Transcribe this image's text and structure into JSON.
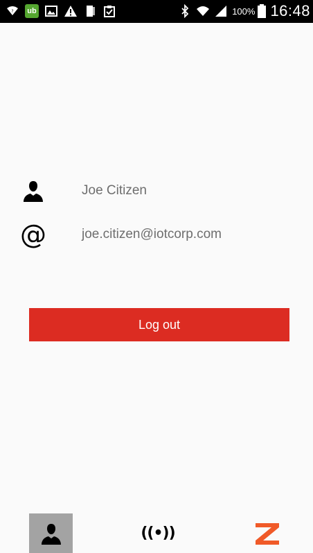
{
  "status_bar": {
    "battery_percent": "100%",
    "time": "16:48",
    "ub_label": "ub",
    "icons": [
      "wifi-icon",
      "ub-app-icon",
      "image-icon",
      "warning-icon",
      "sim-icon",
      "clipboard-check-icon",
      "bluetooth-icon",
      "wifi-icon",
      "signal-icon",
      "battery-icon"
    ]
  },
  "profile": {
    "name": "Joe Citizen",
    "email": "joe.citizen@iotcorp.com",
    "name_icon": "person-icon",
    "email_icon": "at-sign-icon",
    "at_symbol": "@"
  },
  "actions": {
    "logout_label": "Log out"
  },
  "bottom_nav": {
    "items": [
      {
        "icon": "person-icon",
        "active": true
      },
      {
        "icon": "broadcast-icon",
        "glyph": "((•))",
        "active": false
      },
      {
        "icon": "brand-z-logo-icon",
        "active": false
      }
    ]
  },
  "colors": {
    "background": "#fafafa",
    "status_bar": "#000000",
    "logout_button": "#dc2c22",
    "text_secondary": "#6e6e6e",
    "nav_active": "#a3a3a3",
    "brand": "#f05a28",
    "ub_badge": "#55a630"
  }
}
